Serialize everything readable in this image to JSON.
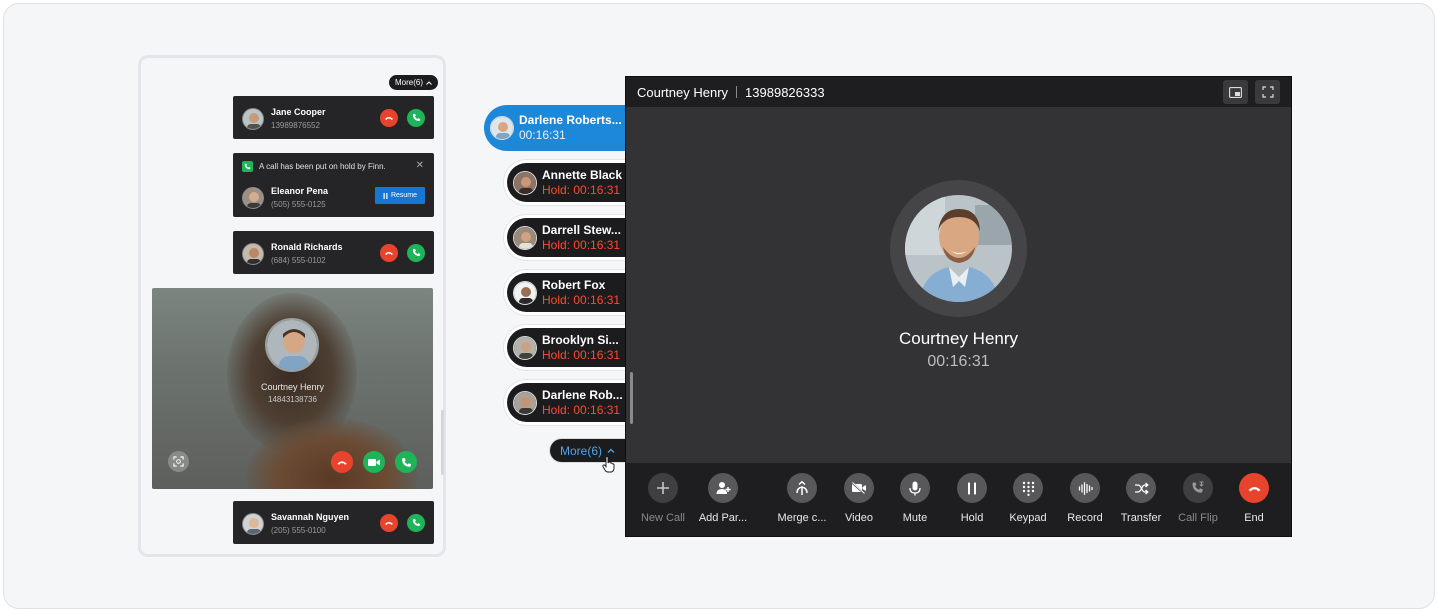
{
  "stack": {
    "more_label": "More(6)",
    "cards": [
      {
        "name": "Jane Cooper",
        "number": "13989876552"
      },
      {
        "name": "Ronald Richards",
        "number": "(684) 555-0102"
      },
      {
        "name": "Savannah Nguyen",
        "number": "(205) 555-0100"
      }
    ],
    "hold_card": {
      "message": "A call has been put on hold by Finn.",
      "name": "Eleanor Pena",
      "number": "(505) 555-0125",
      "resume_label": "Resume"
    },
    "video_card": {
      "name": "Courtney Henry",
      "number": "14843138736"
    }
  },
  "call_list": {
    "items": [
      {
        "name": "Darlene Roberts...",
        "time": "00:16:31"
      },
      {
        "name": "Annette Black",
        "time": "Hold: 00:16:31"
      },
      {
        "name": "Darrell Stew...",
        "time": "Hold: 00:16:31"
      },
      {
        "name": "Robert Fox",
        "time": "Hold: 00:16:31"
      },
      {
        "name": "Brooklyn Si...",
        "time": "Hold: 00:16:31"
      },
      {
        "name": "Darlene Rob...",
        "time": "Hold: 00:16:31"
      }
    ],
    "more_label": "More(6)"
  },
  "call_window": {
    "header_name": "Courtney Henry",
    "header_number": "13989826333",
    "caller_name": "Courtney Henry",
    "duration": "00:16:31",
    "tools": [
      {
        "label": "New Call",
        "icon": "plus-icon"
      },
      {
        "label": "Add Par...",
        "icon": "add-participant-icon"
      },
      {
        "label": "Merge c...",
        "icon": "merge-icon"
      },
      {
        "label": "Video",
        "icon": "video-off-icon"
      },
      {
        "label": "Mute",
        "icon": "mic-icon"
      },
      {
        "label": "Hold",
        "icon": "pause-icon"
      },
      {
        "label": "Keypad",
        "icon": "keypad-icon"
      },
      {
        "label": "Record",
        "icon": "waveform-icon"
      },
      {
        "label": "Transfer",
        "icon": "transfer-icon"
      },
      {
        "label": "Call Flip",
        "icon": "call-flip-icon"
      },
      {
        "label": "End",
        "icon": "hangup-icon"
      }
    ]
  },
  "colors": {
    "accent": "#1d87d8",
    "hold_red": "#ff4a2e",
    "end_red": "#e8442d",
    "answer_green": "#1fb45a"
  }
}
